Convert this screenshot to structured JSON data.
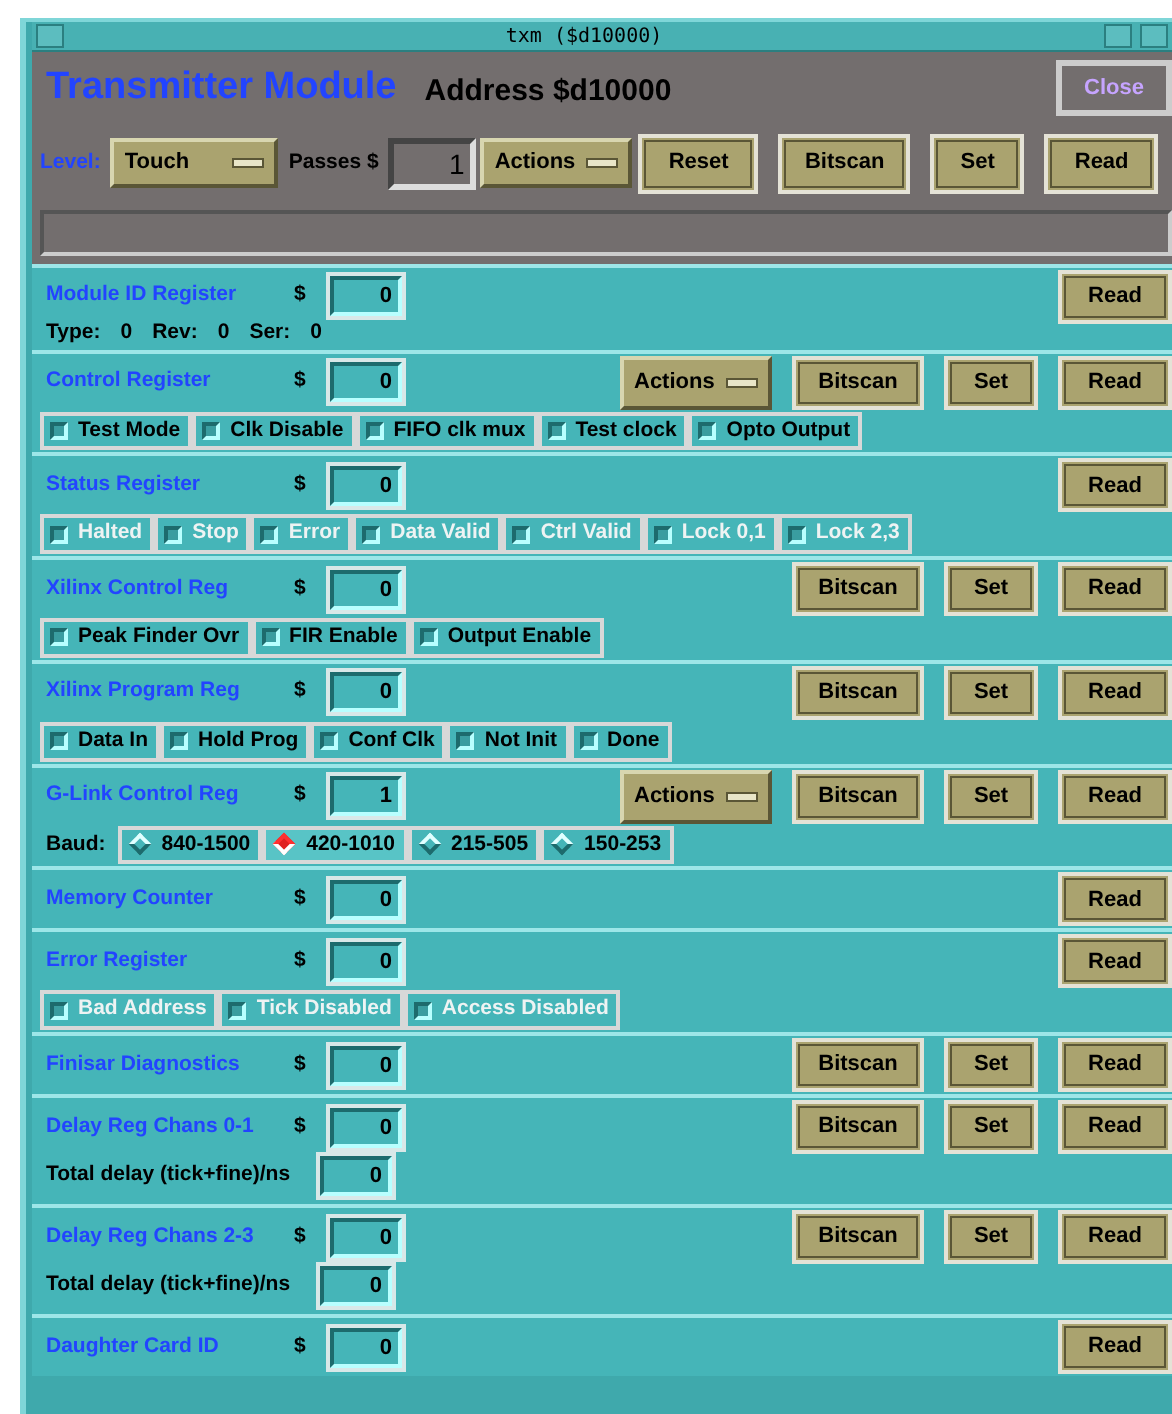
{
  "window": {
    "title": "txm ($d10000)"
  },
  "header": {
    "title": "Transmitter Module",
    "address": "Address $d10000",
    "close_button": {
      "label": "Close",
      "disabled": true
    },
    "level_label": "Level:",
    "level_menu": "Touch",
    "passes_label": "Passes $",
    "passes_value": "1",
    "actions_menu": "Actions",
    "buttons": [
      "Reset",
      "Bitscan",
      "Set",
      "Read"
    ]
  },
  "registers": [
    {
      "name": "Module ID Register",
      "dollar": "$",
      "value": "0",
      "buttons": [
        "Read"
      ],
      "details": {
        "kind": "info",
        "items": [
          {
            "label": "Type:",
            "value": "0"
          },
          {
            "label": "Rev:",
            "value": "0"
          },
          {
            "label": "Ser:",
            "value": "0"
          }
        ]
      }
    },
    {
      "name": "Control Register",
      "dollar": "$",
      "value": "0",
      "actions_menu": "Actions",
      "buttons": [
        "Bitscan",
        "Set",
        "Read"
      ],
      "details": {
        "kind": "checkboxes",
        "items": [
          {
            "label": "Test Mode",
            "checked": false,
            "disabled": false
          },
          {
            "label": "Clk Disable",
            "checked": false,
            "disabled": false
          },
          {
            "label": "FIFO clk mux",
            "checked": false,
            "disabled": false
          },
          {
            "label": "Test clock",
            "checked": false,
            "disabled": false
          },
          {
            "label": "Opto Output",
            "checked": false,
            "disabled": false
          }
        ]
      }
    },
    {
      "name": "Status Register",
      "dollar": "$",
      "value": "0",
      "buttons": [
        "Read"
      ],
      "details": {
        "kind": "checkboxes",
        "items": [
          {
            "label": "Halted",
            "checked": false,
            "disabled": true
          },
          {
            "label": "Stop",
            "checked": false,
            "disabled": true
          },
          {
            "label": "Error",
            "checked": false,
            "disabled": true
          },
          {
            "label": "Data Valid",
            "checked": false,
            "disabled": true
          },
          {
            "label": "Ctrl Valid",
            "checked": false,
            "disabled": true
          },
          {
            "label": "Lock 0,1",
            "checked": false,
            "disabled": true
          },
          {
            "label": "Lock 2,3",
            "checked": false,
            "disabled": true
          }
        ]
      }
    },
    {
      "name": "Xilinx Control Reg",
      "dollar": "$",
      "value": "0",
      "buttons": [
        "Bitscan",
        "Set",
        "Read"
      ],
      "details": {
        "kind": "checkboxes",
        "items": [
          {
            "label": "Peak Finder Ovr",
            "checked": false,
            "disabled": false
          },
          {
            "label": "FIR Enable",
            "checked": false,
            "disabled": false
          },
          {
            "label": "Output Enable",
            "checked": false,
            "disabled": false
          }
        ]
      }
    },
    {
      "name": "Xilinx Program Reg",
      "dollar": "$",
      "value": "0",
      "buttons": [
        "Bitscan",
        "Set",
        "Read"
      ],
      "details": {
        "kind": "checkboxes",
        "items": [
          {
            "label": "Data In",
            "checked": false,
            "disabled": false
          },
          {
            "label": "Hold Prog",
            "checked": false,
            "disabled": false
          },
          {
            "label": "Conf Clk",
            "checked": false,
            "disabled": false
          },
          {
            "label": "Not Init",
            "checked": false,
            "disabled": false
          },
          {
            "label": "Done",
            "checked": false,
            "disabled": false
          }
        ]
      }
    },
    {
      "name": "G-Link Control Reg",
      "dollar": "$",
      "value": "1",
      "actions_menu": "Actions",
      "buttons": [
        "Bitscan",
        "Set",
        "Read"
      ],
      "details": {
        "kind": "radios",
        "label": "Baud:",
        "items": [
          {
            "label": "840-1500",
            "selected": false
          },
          {
            "label": "420-1010",
            "selected": true
          },
          {
            "label": "215-505",
            "selected": false
          },
          {
            "label": "150-253",
            "selected": false
          }
        ]
      }
    },
    {
      "name": "Memory Counter",
      "dollar": "$",
      "value": "0",
      "buttons": [
        "Read"
      ]
    },
    {
      "name": "Error Register",
      "dollar": "$",
      "value": "0",
      "buttons": [
        "Read"
      ],
      "details": {
        "kind": "checkboxes",
        "items": [
          {
            "label": "Bad Address",
            "checked": false,
            "disabled": true
          },
          {
            "label": "Tick Disabled",
            "checked": false,
            "disabled": true
          },
          {
            "label": "Access Disabled",
            "checked": false,
            "disabled": true
          }
        ]
      }
    },
    {
      "name": "Finisar Diagnostics",
      "dollar": "$",
      "value": "0",
      "buttons": [
        "Bitscan",
        "Set",
        "Read"
      ]
    },
    {
      "name": "Delay Reg Chans 0-1",
      "dollar": "$",
      "value": "0",
      "buttons": [
        "Bitscan",
        "Set",
        "Read"
      ],
      "details": {
        "kind": "field",
        "label": "Total delay (tick+fine)/ns",
        "value": "0"
      }
    },
    {
      "name": "Delay Reg Chans 2-3",
      "dollar": "$",
      "value": "0",
      "buttons": [
        "Bitscan",
        "Set",
        "Read"
      ],
      "details": {
        "kind": "field",
        "label": "Total delay (tick+fine)/ns",
        "value": "0"
      }
    },
    {
      "name": "Daughter Card ID",
      "dollar": "$",
      "value": "0",
      "buttons": [
        "Read"
      ]
    }
  ]
}
